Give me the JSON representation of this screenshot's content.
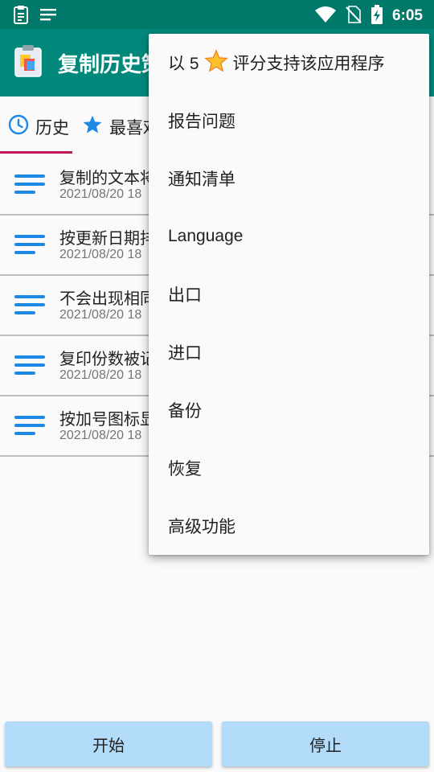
{
  "status_bar": {
    "time": "6:05",
    "icons": [
      "clipboard-icon",
      "notes-icon",
      "wifi-icon",
      "no-sim-icon",
      "battery-charging-icon"
    ]
  },
  "app_bar": {
    "title": "复制历史策"
  },
  "tabs": [
    {
      "label": "历史",
      "icon": "clock-icon"
    },
    {
      "label": "最喜欢",
      "icon": "star-icon"
    }
  ],
  "list": {
    "items": [
      {
        "title": "复制的文本将",
        "date": "2021/08/20 18"
      },
      {
        "title": "按更新日期排",
        "date": "2021/08/20 18"
      },
      {
        "title": "不会出现相同",
        "date": "2021/08/20 18"
      },
      {
        "title": "复印份数被记",
        "date": "2021/08/20 18"
      },
      {
        "title": "按加号图标显",
        "date": "2021/08/20 18"
      }
    ]
  },
  "menu": {
    "rate": {
      "prefix": "以 5",
      "suffix": "评分支持该应用程序"
    },
    "items": [
      "报告问题",
      "通知清单",
      "Language",
      "出口",
      "进口",
      "备份",
      "恢复",
      "高级功能"
    ]
  },
  "buttons": {
    "start": "开始",
    "stop": "停止"
  },
  "colors": {
    "status_bar": "#00796b",
    "app_bar": "#00897b",
    "tab_indicator": "#c2185b",
    "list_icon": "#1e88e5",
    "button": "#b3dcfa"
  }
}
